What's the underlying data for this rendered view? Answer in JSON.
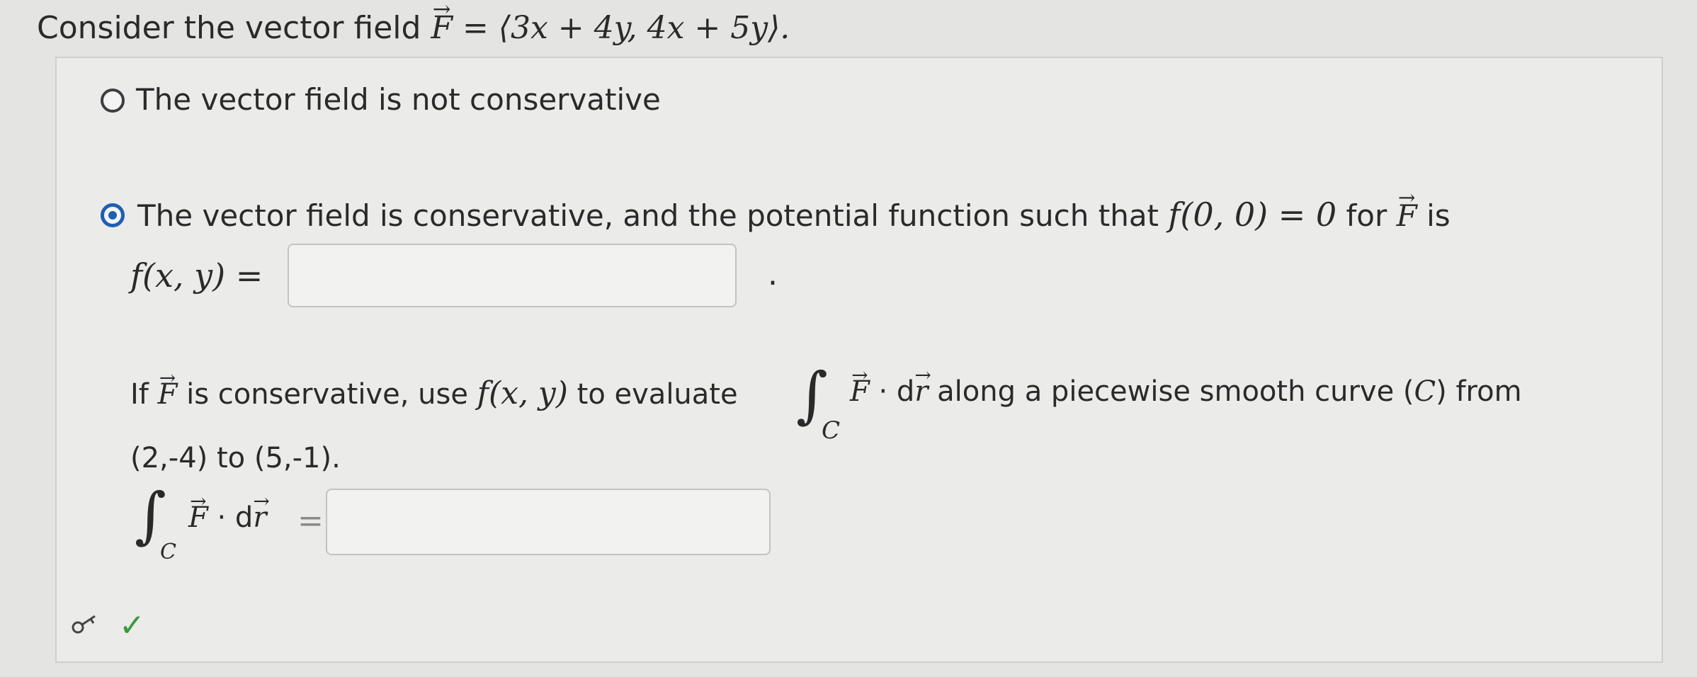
{
  "question": {
    "prefix": "Consider the vector field ",
    "F_symbol": "F",
    "equals_expr": " = ⟨3x + 4y, 4x + 5y⟩."
  },
  "options": [
    {
      "label": "The vector field is not conservative",
      "selected": false
    },
    {
      "label_before": "The vector field is conservative, and the potential function such that ",
      "condition": "f(0, 0) = 0",
      "label_mid": " for ",
      "F_symbol": "F",
      "label_end": " is",
      "selected": true
    }
  ],
  "potential": {
    "lhs": "f(x, y) =",
    "input_value": "",
    "period": "."
  },
  "line_integral": {
    "if_text": "If ",
    "F_symbol": "F",
    "text1": " is conservative, use ",
    "func": "f(x, y)",
    "text2": " to evaluate ",
    "integral_sign": "∫",
    "sub_C": "C",
    "integrand_F": "F",
    "integrand_rest": " · d",
    "r_symbol": "r",
    "text3": " along a piecewise smooth curve (",
    "curve": "C",
    "text4": ") from",
    "endpoints": "(2,-4) to (5,-1).",
    "answer_F": "F",
    "answer_rest": " · d",
    "answer_r": "r",
    "answer_eq": "=",
    "input_value": ""
  },
  "colors": {
    "radio_selected": "#1f5fb2",
    "check": "#3a9a3a"
  },
  "icons": [
    "key-icon",
    "check-icon"
  ],
  "status": {
    "check_symbol": "✓"
  }
}
